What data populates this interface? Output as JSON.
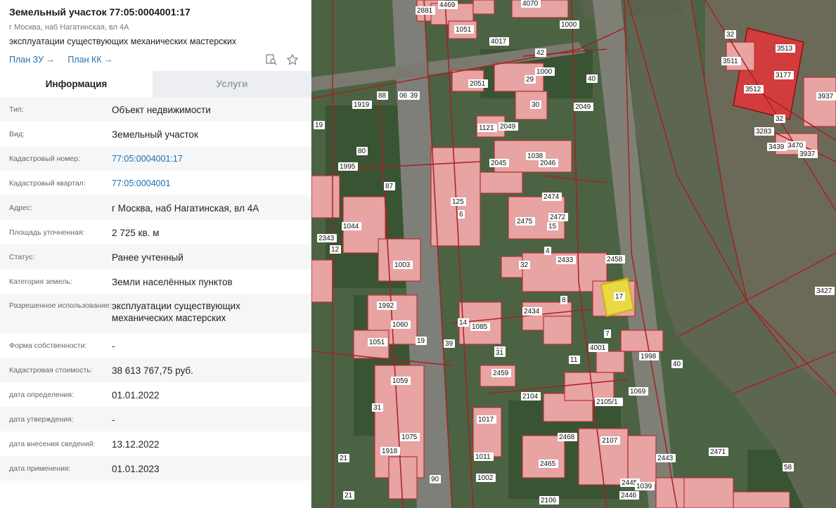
{
  "header": {
    "title": "Земельный участок 77:05:0004001:17",
    "address": "г Москва, наб Нагатинская, вл 4А",
    "usage": "эксплуатации существующих механических мастерских",
    "link_plan_zu": "План ЗУ →",
    "link_plan_kk": "План КК →"
  },
  "tabs": {
    "info": "Информация",
    "services": "Услуги"
  },
  "rows": [
    {
      "label": "Тип:",
      "value": "Объект недвижимости"
    },
    {
      "label": "Вид:",
      "value": "Земельный участок"
    },
    {
      "label": "Кадастровый номер:",
      "value": "77:05:0004001:17"
    },
    {
      "label": "Кадастровый квартал:",
      "value": "77:05:0004001"
    },
    {
      "label": "Адрес:",
      "value": "г Москва, наб Нагатинская, вл 4А"
    },
    {
      "label": "Площадь уточненная:",
      "value": "2 725 кв. м"
    },
    {
      "label": "Статус:",
      "value": "Ранее учтенный"
    },
    {
      "label": "Категория земель:",
      "value": "Земли населённых пунктов"
    },
    {
      "label": "Разрешенное использование:",
      "value": "эксплуатации существующих механических мастерских"
    },
    {
      "label": "Форма собственности:",
      "value": "-"
    },
    {
      "label": "Кадастровая стоимость:",
      "value": "38 613 767,75 руб."
    },
    {
      "label": "дата определения:",
      "value": "01.01.2022"
    },
    {
      "label": "дата утверждения:",
      "value": "-"
    },
    {
      "label": "дата внесения сведений:",
      "value": "13.12.2022"
    },
    {
      "label": "дата применения:",
      "value": "01.01.2023"
    }
  ],
  "map_labels": [
    "2881",
    "4469",
    "4070",
    "1051",
    "1000",
    "4017",
    "32",
    "3513",
    "3511",
    "3177",
    "3512",
    "3937",
    "42",
    "1000",
    "29",
    "40",
    "2051",
    "88",
    "06",
    "39",
    "1919",
    "30",
    "2049",
    "32",
    "19",
    "1121",
    "2049",
    "3283",
    "3439",
    "3470",
    "3937",
    "80",
    "1995",
    "1038",
    "2046",
    "2045",
    "87",
    "125",
    "6",
    "2474",
    "2472",
    "15",
    "2475",
    "1044",
    "2343",
    "12",
    "1003",
    "2433",
    "2458",
    "4",
    "32",
    "3427",
    "17",
    "1992",
    "1060",
    "2434",
    "8",
    "1085",
    "14",
    "1051",
    "19",
    "7",
    "29",
    "39",
    "4001",
    "1998",
    "31",
    "40",
    "2459",
    "11",
    "1059",
    "1069",
    "2104",
    "2105/1",
    "31",
    "1017",
    "1075",
    "1918",
    "21",
    "2468",
    "2107",
    "2471",
    "1011",
    "2465",
    "2443",
    "1002",
    "2445",
    "1039",
    "58",
    "2446",
    "90",
    "2106",
    "21"
  ]
}
